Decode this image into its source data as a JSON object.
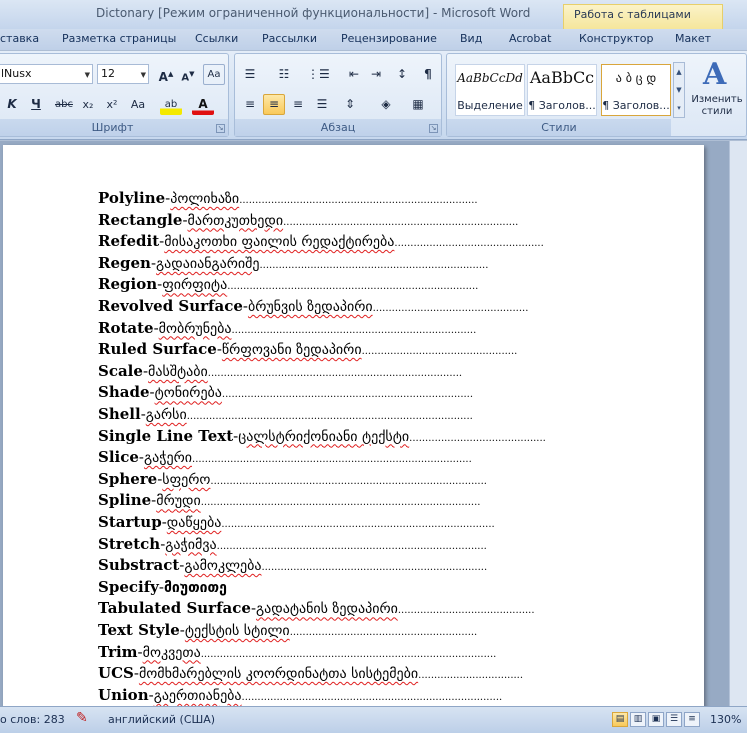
{
  "window": {
    "title": "Dictonary [Режим ограниченной функциональности] - Microsoft Word",
    "context_tab_title": "Работа с таблицами"
  },
  "tabs": [
    "ставка",
    "Разметка страницы",
    "Ссылки",
    "Рассылки",
    "Рецензирование",
    "Вид",
    "Acrobat",
    "Конструктор",
    "Макет"
  ],
  "ribbon": {
    "font": {
      "name": "lNusx",
      "size": "12",
      "label": "Шрифт",
      "grow": "A",
      "shrink": "A",
      "clear": "Aa",
      "bold": "K",
      "underline": "Ч",
      "strike": "abc",
      "subscript": "x₂",
      "superscript": "x²",
      "case": "Aa",
      "highlight": "ab",
      "color": "A"
    },
    "paragraph": {
      "label": "Абзац",
      "pilcrow": "¶"
    },
    "styles": {
      "label": "Стили",
      "items": [
        {
          "sample": "AaBbCcDd",
          "name": "Выделение"
        },
        {
          "sample": "AaBbCc",
          "name": "¶ Заголов..."
        },
        {
          "sample": "ა ბ ც დ",
          "name": "¶ Заголов..."
        }
      ],
      "change_styles": "Изменить стили"
    }
  },
  "document": {
    "entries": [
      {
        "term": "Polyline",
        "geo": "პოლიხაზი",
        "dots": "..........................................................................."
      },
      {
        "term": "Rectangle",
        "geo": "მართკუთხედი",
        "dots": ".........................................................................."
      },
      {
        "term": "Refedit",
        "geo": "მისაკოთხი ფაილის რედაქტირება",
        "dots": "..............................................."
      },
      {
        "term": "Regen",
        "geo": "გადაიანგარიშე",
        "dots": "........................................................................"
      },
      {
        "term": "Region",
        "geo": "ფირფიტა",
        "dots": "..............................................................................."
      },
      {
        "term": "Revolved Surface",
        "geo": "ბრუნვის ზედაპირი",
        "dots": "................................................."
      },
      {
        "term": "Rotate",
        "geo": "მობრუნება",
        "dots": "............................................................................."
      },
      {
        "term": "Ruled Surface",
        "geo": "წრფოვანი ზედაპირი",
        "dots": "................................................."
      },
      {
        "term": "Scale",
        "geo": "მასშტაბი",
        "dots": "................................................................................"
      },
      {
        "term": "Shade",
        "geo": "ტონირება",
        "dots": "..............................................................................."
      },
      {
        "term": "Shell",
        "geo": "გარსი",
        "dots": ".........................................................................................."
      },
      {
        "term": "Single Line Text",
        "geo": "ცალსტრიქონიანი ტექსტი",
        "dots": "..........................................."
      },
      {
        "term": "Slice",
        "geo": "გაჭერი",
        "dots": "........................................................................................"
      },
      {
        "term": "Sphere",
        "geo": "სფერო",
        "dots": "......................................................................................."
      },
      {
        "term": "Spline",
        "geo": "მრუდი",
        "dots": "........................................................................................"
      },
      {
        "term": "Startup",
        "geo": "დაწყება",
        "dots": "......................................................................................"
      },
      {
        "term": "Stretch",
        "geo": "გაჭიმვა",
        "dots": "....................................................................................."
      },
      {
        "term": "Substract",
        "geo": "გამოკლება",
        "dots": "......................................................................."
      },
      {
        "term": "Specify",
        "geo": "მიუთითე",
        "dots": ""
      },
      {
        "term": "Tabulated Surface",
        "geo": "გადატანის ზედაპირი",
        "dots": "..........................................."
      },
      {
        "term": "Text Style",
        "geo": "ტექსტის სტილი",
        "dots": "..........................................................."
      },
      {
        "term": "Trim",
        "geo": "მოკვეთა",
        "dots": "............................................................................................."
      },
      {
        "term": "UCS",
        "geo": "მომხმარებლის კოორდინატთა სისტემები",
        "dots": "................................."
      },
      {
        "term": "Union",
        "geo": "გაერთიანება",
        "dots": ".................................................................................."
      }
    ]
  },
  "statusbar": {
    "words": "о слов: 283",
    "language": "английский (США)",
    "zoom": "130%"
  }
}
